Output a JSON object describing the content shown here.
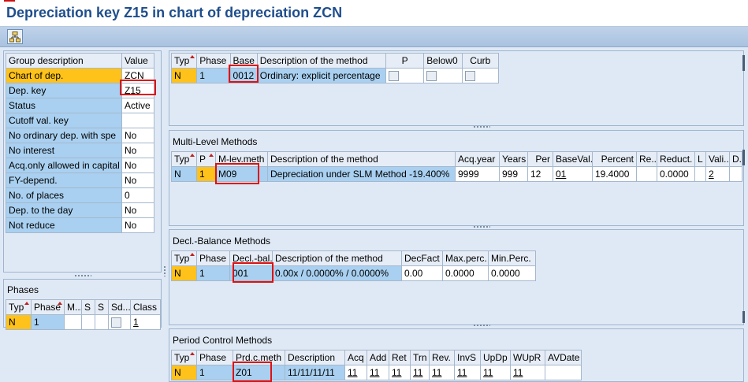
{
  "window": {
    "title": "Depreciation key Z15 in chart of depreciation ZCN"
  },
  "toolbar": {
    "icon": "hierarchy-icon"
  },
  "left_attributes": {
    "headers": [
      "Group description",
      "Value"
    ],
    "rows": [
      {
        "label": "Chart of dep.",
        "value": "ZCN",
        "selected": true
      },
      {
        "label": "Dep. key",
        "value": "Z15"
      },
      {
        "label": "Status",
        "value": "Active"
      },
      {
        "label": "Cutoff val. key",
        "value": ""
      },
      {
        "label": "No ordinary dep. with spe",
        "value": "No"
      },
      {
        "label": "No interest",
        "value": "No"
      },
      {
        "label": "Acq.only allowed in capital",
        "value": "No"
      },
      {
        "label": "FY-depend.",
        "value": "No"
      },
      {
        "label": "No. of places",
        "value": "0"
      },
      {
        "label": "Dep. to the day",
        "value": "No"
      },
      {
        "label": "Not reduce",
        "value": "No"
      }
    ]
  },
  "phases": {
    "title": "Phases",
    "headers": [
      "Typ",
      "Phase",
      "M...",
      "S",
      "S",
      "Sd...",
      "Class"
    ],
    "row": {
      "typ": "N",
      "phase": "1",
      "m": "",
      "s1": "",
      "s2": "",
      "class": "1"
    }
  },
  "base_methods": {
    "headers": [
      "Typ",
      "Phase",
      "Base",
      "Description of the method",
      "P",
      "Below0",
      "Curb"
    ],
    "row": {
      "typ": "N",
      "phase": "1",
      "base": "0012",
      "description": "Ordinary: explicit percentage"
    }
  },
  "multi_level": {
    "title": "Multi-Level Methods",
    "headers": [
      "Typ",
      "P",
      "M-lev.meth",
      "Description of the method",
      "Acq.year",
      "Years",
      "Per",
      "BaseVal.",
      "Percent",
      "Re...",
      "Reduct.",
      "L",
      "Vali...",
      "D..."
    ],
    "row": {
      "typ": "N",
      "p": "1",
      "method": "M09",
      "description": "Depreciation under SLM Method -19.400%",
      "acq_year": "9999",
      "years": "999",
      "per": "12",
      "baseval": "01",
      "percent": "19.4000",
      "re": "",
      "reduct": "0.0000",
      "l": "",
      "vali": "2",
      "d": ""
    }
  },
  "decl_balance": {
    "title": "Decl.-Balance Methods",
    "headers": [
      "Typ",
      "Phase",
      "Decl.-bal.",
      "Description of the method",
      "DecFact",
      "Max.perc.",
      "Min.Perc."
    ],
    "row": {
      "typ": "N",
      "phase": "1",
      "method": "001",
      "description": "0.00x / 0.0000% / 0.0000%",
      "decfact": "0.00",
      "max": "0.0000",
      "min": "0.0000"
    }
  },
  "period_control": {
    "title": "Period Control Methods",
    "headers": [
      "Typ",
      "Phase",
      "Prd.c.meth",
      "Description",
      "Acq",
      "Add",
      "Ret",
      "Trn",
      "Rev.",
      "InvS",
      "UpDp",
      "WUpR",
      "AVDate"
    ],
    "row": {
      "typ": "N",
      "phase": "1",
      "method": "Z01",
      "description": "11/11/11/11",
      "acq": "11",
      "add": "11",
      "ret": "11",
      "trn": "11",
      "rev": "11",
      "invs": "11",
      "updp": "11",
      "wupr": "11",
      "avdate": ""
    }
  },
  "colors": {
    "key_cell": "#ffc21a",
    "value_cell": "#a9d0f0",
    "highlight": "#e01010",
    "title": "#1f4e8c"
  }
}
